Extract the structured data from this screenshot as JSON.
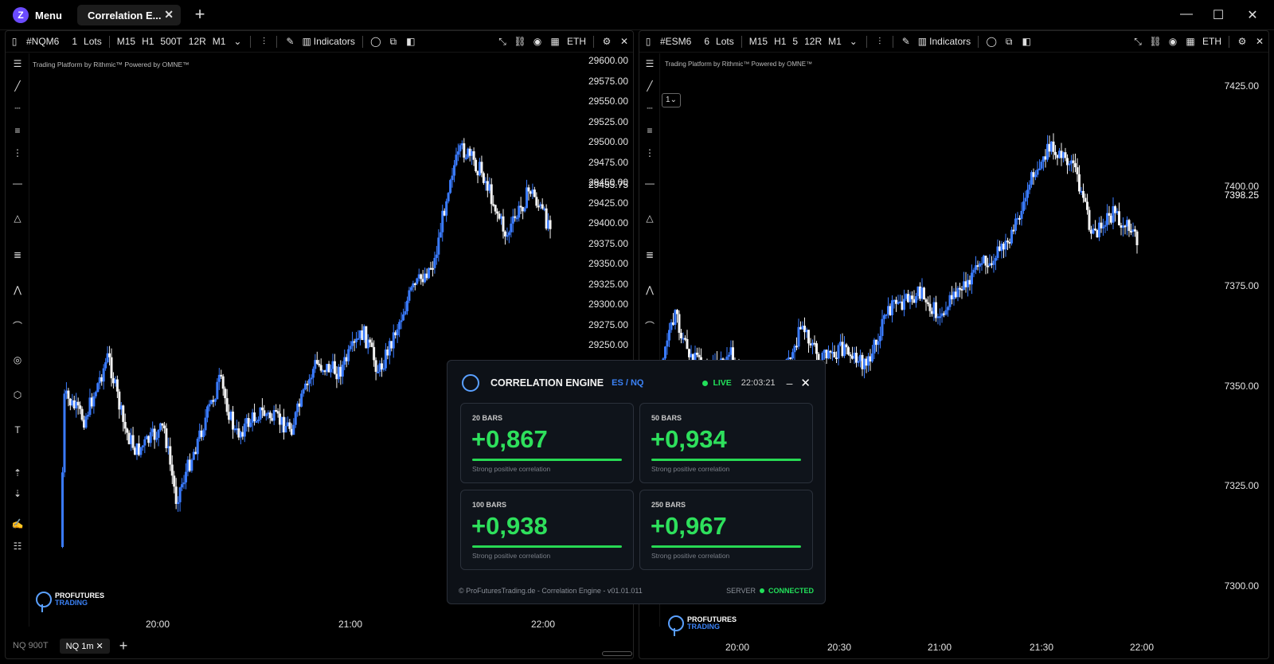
{
  "titlebar": {
    "menu_label": "Menu",
    "menu_logo": "Z",
    "tab_label": "Correlation E...",
    "tab_close": "✕",
    "add_tab": "+",
    "minimize": "—",
    "maximize": "☐",
    "close": "✕"
  },
  "left_chart": {
    "symbol": "#NQM6",
    "lots_value": "1",
    "lots_label": "Lots",
    "timeframes": [
      "M15",
      "H1",
      "500T",
      "12R",
      "M1"
    ],
    "indicators_label": "Indicators",
    "session": "ETH",
    "credit_platform": "Trading Platform by Rithmic™",
    "credit_powered": "Powered by OMNE™",
    "current_price": "29455.75",
    "price_ticks": [
      "29600.00",
      "29575.00",
      "29550.00",
      "29525.00",
      "29500.00",
      "29475.00",
      "29450.00",
      "29425.00",
      "29400.00",
      "29375.00",
      "29350.00",
      "29325.00",
      "29300.00",
      "29275.00",
      "29250.00"
    ],
    "time_ticks": [
      "20:00",
      "21:00",
      "22:00"
    ],
    "bottom_tabs": [
      "NQ 900T",
      "NQ 1m"
    ],
    "bottom_tab_close": "✕",
    "bottom_add": "+"
  },
  "right_chart": {
    "symbol": "#ESM6",
    "lots_value": "6",
    "lots_label": "Lots",
    "timeframes": [
      "M15",
      "H1",
      "5",
      "12R",
      "M1"
    ],
    "indicators_label": "Indicators",
    "session": "ETH",
    "credit_platform": "Trading Platform by Rithmic™",
    "credit_powered": "Powered by OMNE™",
    "chip_label": "1",
    "current_price": "7398.25",
    "price_ticks": [
      "7425.00",
      "7400.00",
      "7375.00",
      "7350.00",
      "7325.00",
      "7300.00"
    ],
    "time_ticks": [
      "20:00",
      "20:30",
      "21:00",
      "21:30",
      "22:00"
    ]
  },
  "brand": {
    "line1": "PROFUTURES",
    "line2": "TRADING"
  },
  "engine": {
    "title": "CORRELATION ENGINE",
    "pair": "ES / NQ",
    "live_label": "LIVE",
    "time": "22:03:21",
    "minimize": "–",
    "close": "✕",
    "cards": [
      {
        "title": "20 BARS",
        "value": "+0,867",
        "desc": "Strong positive correlation"
      },
      {
        "title": "50 BARS",
        "value": "+0,934",
        "desc": "Strong positive correlation"
      },
      {
        "title": "100 BARS",
        "value": "+0,938",
        "desc": "Strong positive correlation"
      },
      {
        "title": "250 BARS",
        "value": "+0,967",
        "desc": "Strong positive correlation"
      }
    ],
    "footer": "© ProFuturesTrading.de - Correlation Engine - v01.01.011",
    "server_label": "SERVER",
    "server_status": "CONNECTED"
  },
  "colors": {
    "bull": "#3a7bff",
    "bear": "#f2f2f2",
    "accent_green": "#2ee05c",
    "accent_blue": "#3b82f6"
  }
}
